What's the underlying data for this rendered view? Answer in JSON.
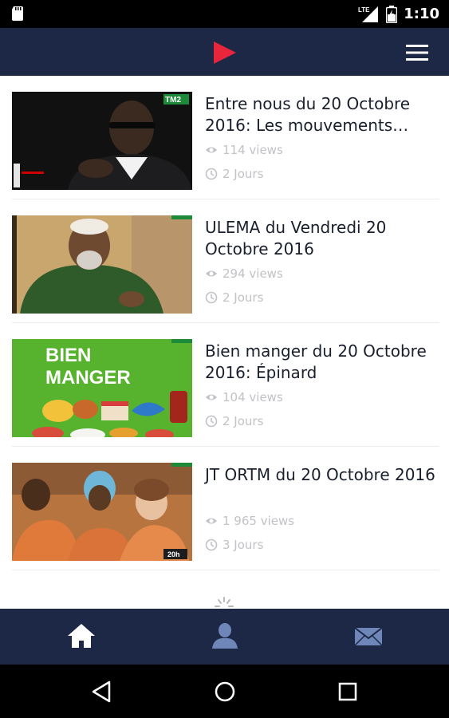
{
  "status_bar": {
    "time": "1:10",
    "network_label": "LTE"
  },
  "app_bar": {
    "logo_icon": "play-logo-icon",
    "menu_icon": "hamburger-menu-icon"
  },
  "colors": {
    "nav_bg": "#1c2846",
    "logo_red": "#e8253b",
    "meta_gray": "#c2c2c6"
  },
  "videos": [
    {
      "title": "Entre nous du 20 Octobre 2016: Les mouvements…",
      "views": "114 views",
      "age": "2 Jours"
    },
    {
      "title": "ULEMA du Vendredi 20 Octobre 2016",
      "views": "294 views",
      "age": "2 Jours"
    },
    {
      "title": "Bien manger du 20 Octobre 2016: Épinard",
      "views": "104 views",
      "age": "2 Jours",
      "thumb_text": [
        "BIEN",
        "MANGER"
      ]
    },
    {
      "title": "JT ORTM du 20 Octobre 2016",
      "views": "1 965 views",
      "age": "3 Jours",
      "thumb_badge": "20h"
    }
  ],
  "thumb_logo": "TM2",
  "bottom_nav": [
    {
      "icon": "home-icon",
      "active": true
    },
    {
      "icon": "profile-icon",
      "active": false
    },
    {
      "icon": "mail-icon",
      "active": false
    }
  ],
  "system_nav": [
    "back-icon",
    "home-circle-icon",
    "recents-icon"
  ]
}
